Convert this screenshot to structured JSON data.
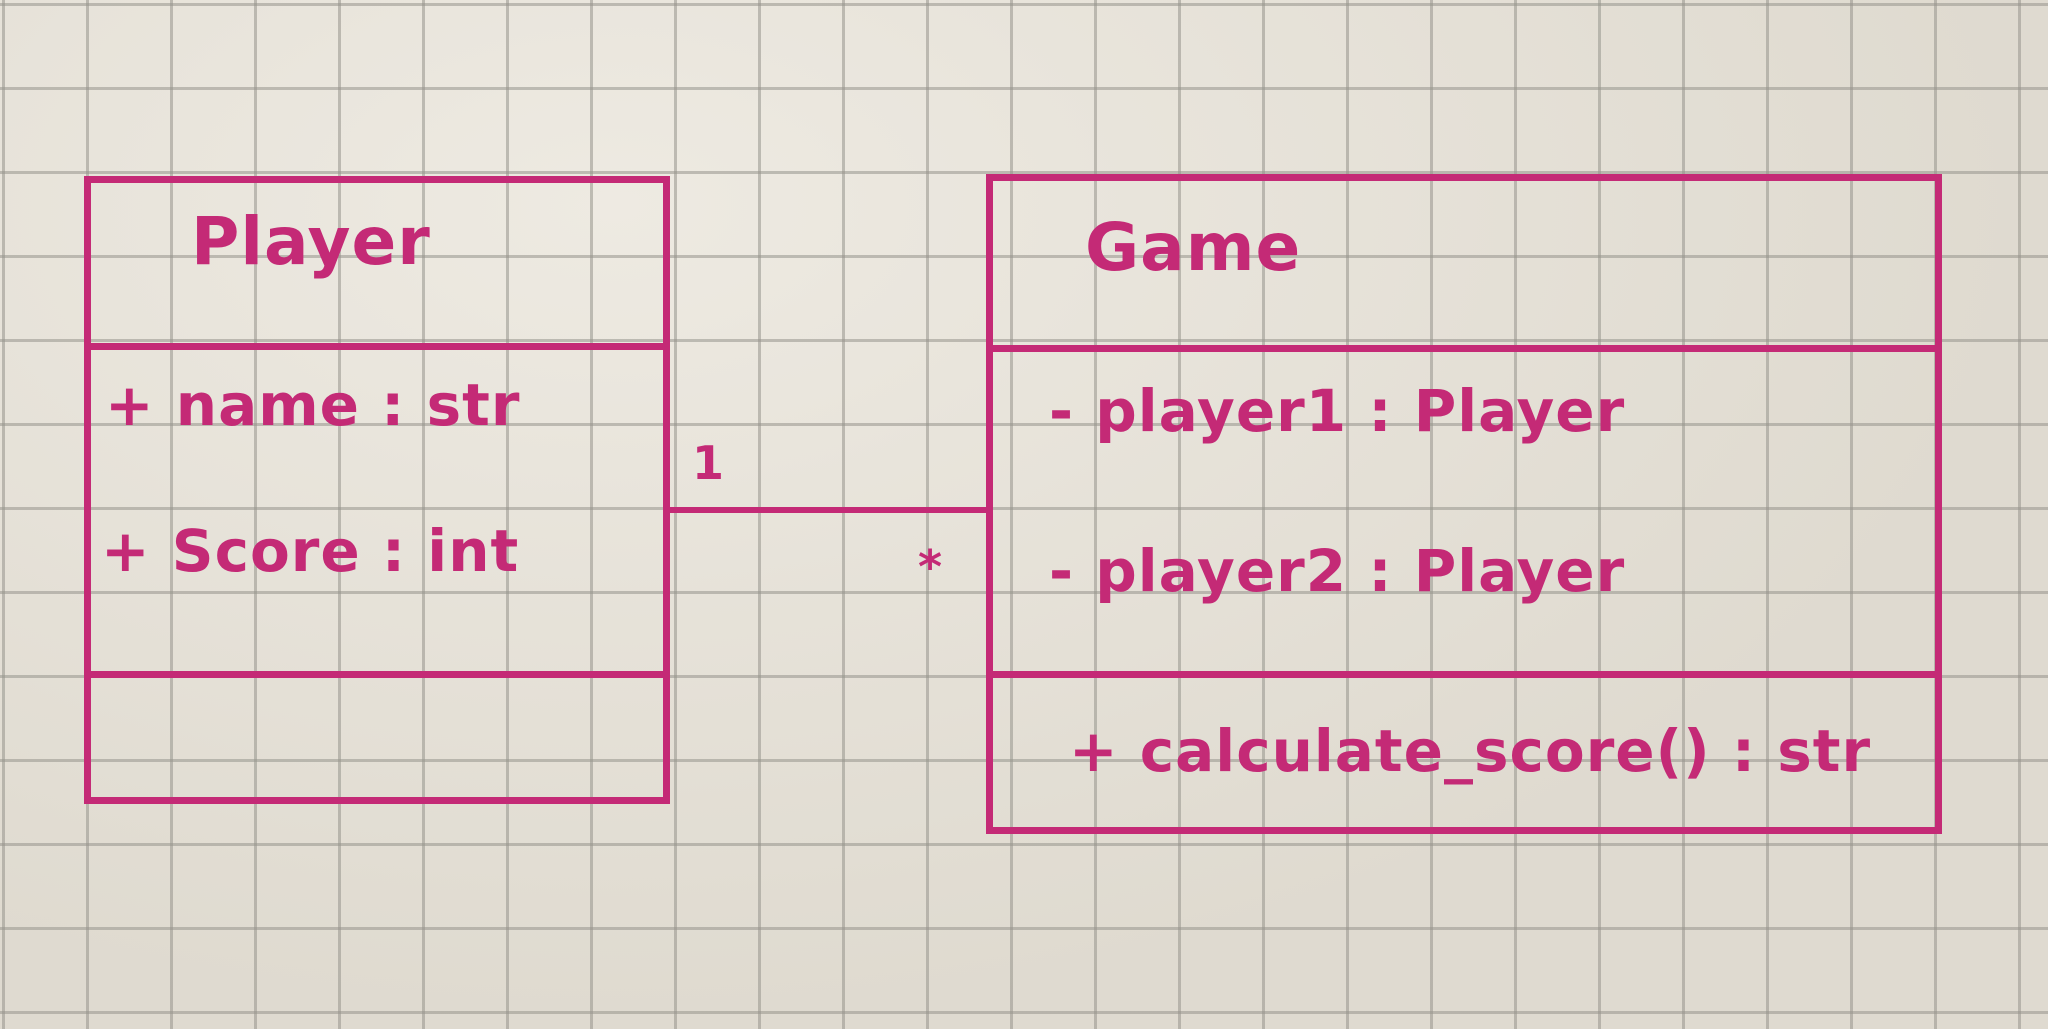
{
  "classes": {
    "player": {
      "name": "Player",
      "attributes": [
        "+ name : str",
        "+ Score : int"
      ],
      "methods": []
    },
    "game": {
      "name": "Game",
      "attributes": [
        "- player1 : Player",
        "- player2 : Player"
      ],
      "methods": [
        "+ calculate_score() : str"
      ]
    }
  },
  "association": {
    "player_multiplicity": "1",
    "game_multiplicity": "*"
  },
  "colors": {
    "ink": "#c42a76",
    "paper": "#e8e3d8",
    "grid": "#96948c"
  }
}
